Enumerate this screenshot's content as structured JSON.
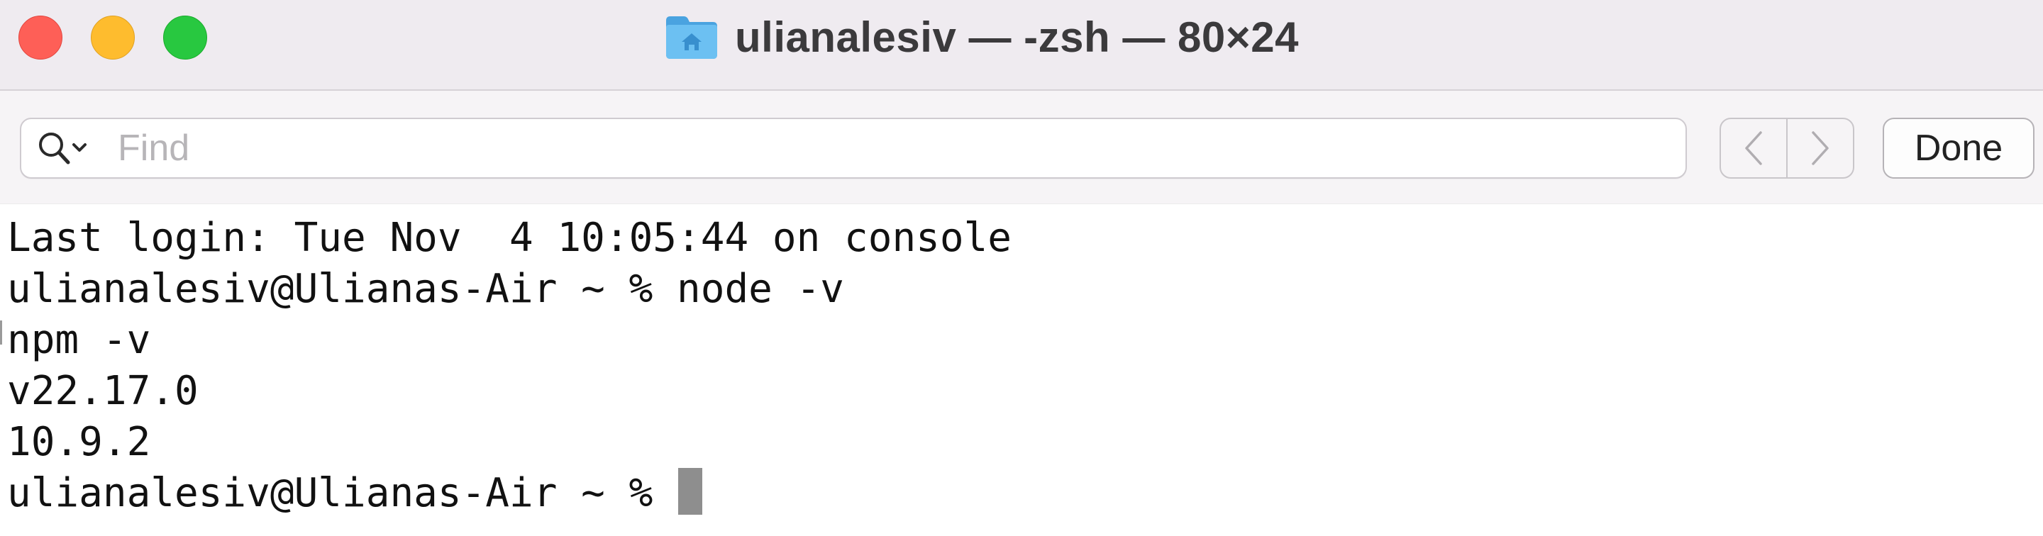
{
  "window": {
    "title": "ulianalesiv — -zsh — 80×24",
    "title_icon": "home-folder-icon",
    "traffic_lights": {
      "close_color": "#fe5f57",
      "minimize_color": "#febc2e",
      "zoom_color": "#28c840"
    }
  },
  "find_bar": {
    "search_icon": "magnifier-with-dropdown-icon",
    "placeholder": "Find",
    "value": "",
    "previous_icon": "chevron-left-icon",
    "next_icon": "chevron-right-icon",
    "done_label": "Done"
  },
  "terminal": {
    "lines": [
      "Last login: Tue Nov  4 10:05:44 on console",
      "ulianalesiv@Ulianas-Air ~ % node -v",
      "npm -v",
      "v22.17.0",
      "10.9.2",
      "ulianalesiv@Ulianas-Air ~ % "
    ],
    "cursor_color": "#8e8e8e"
  }
}
